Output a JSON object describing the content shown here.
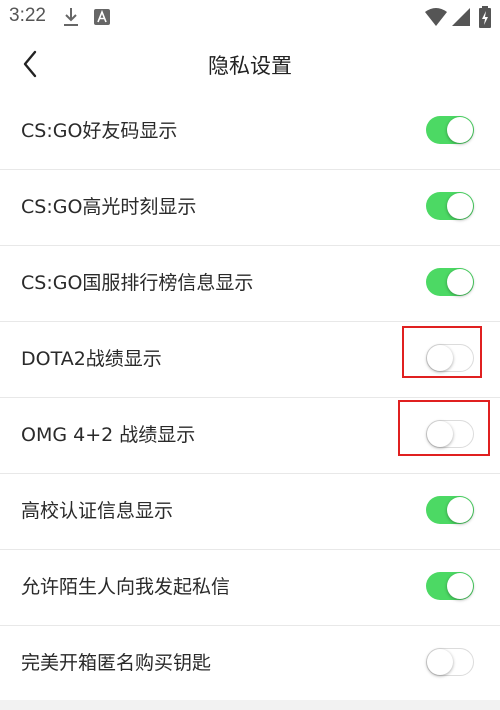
{
  "status_bar": {
    "time": "3:22"
  },
  "header": {
    "title": "隐私设置"
  },
  "settings": [
    {
      "label": "CS:GO好友码显示",
      "enabled": true
    },
    {
      "label": "CS:GO高光时刻显示",
      "enabled": true
    },
    {
      "label": "CS:GO国服排行榜信息显示",
      "enabled": true
    },
    {
      "label": "DOTA2战绩显示",
      "enabled": false
    },
    {
      "label": "OMG 4+2 战绩显示",
      "enabled": false
    },
    {
      "label": "高校认证信息显示",
      "enabled": true
    },
    {
      "label": "允许陌生人向我发起私信",
      "enabled": true
    },
    {
      "label": "完美开箱匿名购买钥匙",
      "enabled": false
    }
  ],
  "colors": {
    "toggle_on": "#4cd964",
    "highlight": "#e02020"
  }
}
